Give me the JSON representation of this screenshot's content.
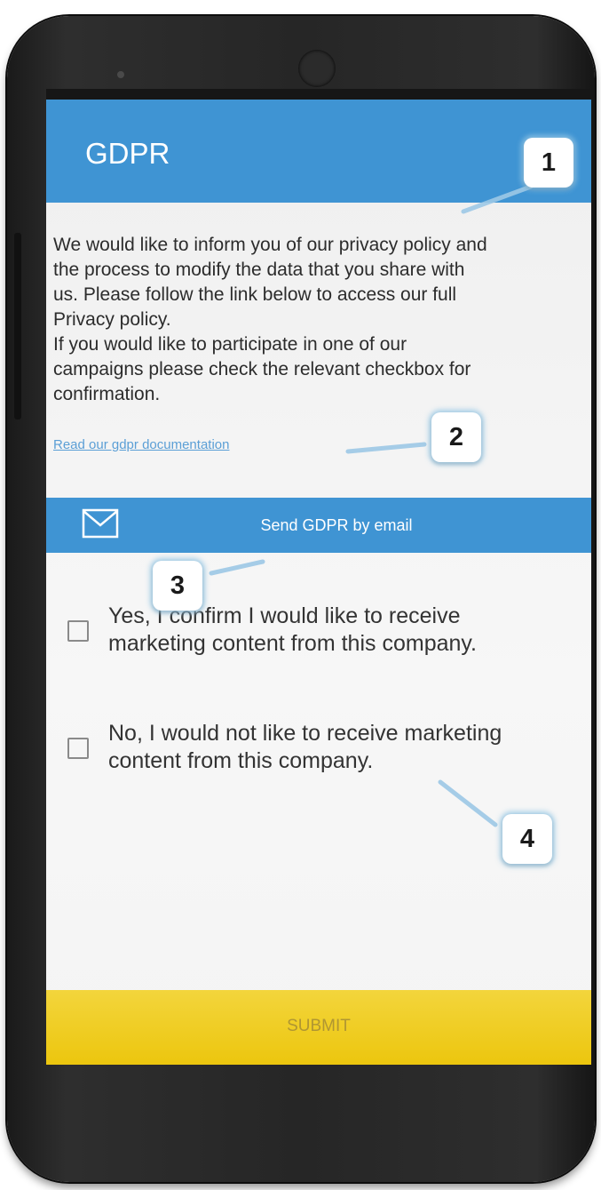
{
  "app": {
    "title": "GDPR"
  },
  "intro": {
    "lines": [
      "We would like to inform you of our privacy policy and",
      "the process to modify the data that you share with",
      "us. Please follow the link below to access our full",
      "Privacy policy.",
      "If you would like to participate in one of our",
      "campaigns please check the relevant checkbox for",
      "confirmation."
    ]
  },
  "link": {
    "label": "Read our gdpr documentation"
  },
  "email_button": {
    "label": "Send GDPR by email",
    "icon": "mail-icon"
  },
  "options": [
    {
      "lines": [
        "Yes, I confirm I would like to receive",
        "marketing content from this company."
      ],
      "checked": false
    },
    {
      "lines": [
        "No, I would not like to receive marketing",
        "content from this company."
      ],
      "checked": false
    }
  ],
  "submit": {
    "label": "SUBMIT"
  },
  "callouts": [
    "1",
    "2",
    "3",
    "4"
  ],
  "colors": {
    "primary": "#3f94d3",
    "submit": "#ecc60e",
    "link": "#5b9fd6"
  }
}
